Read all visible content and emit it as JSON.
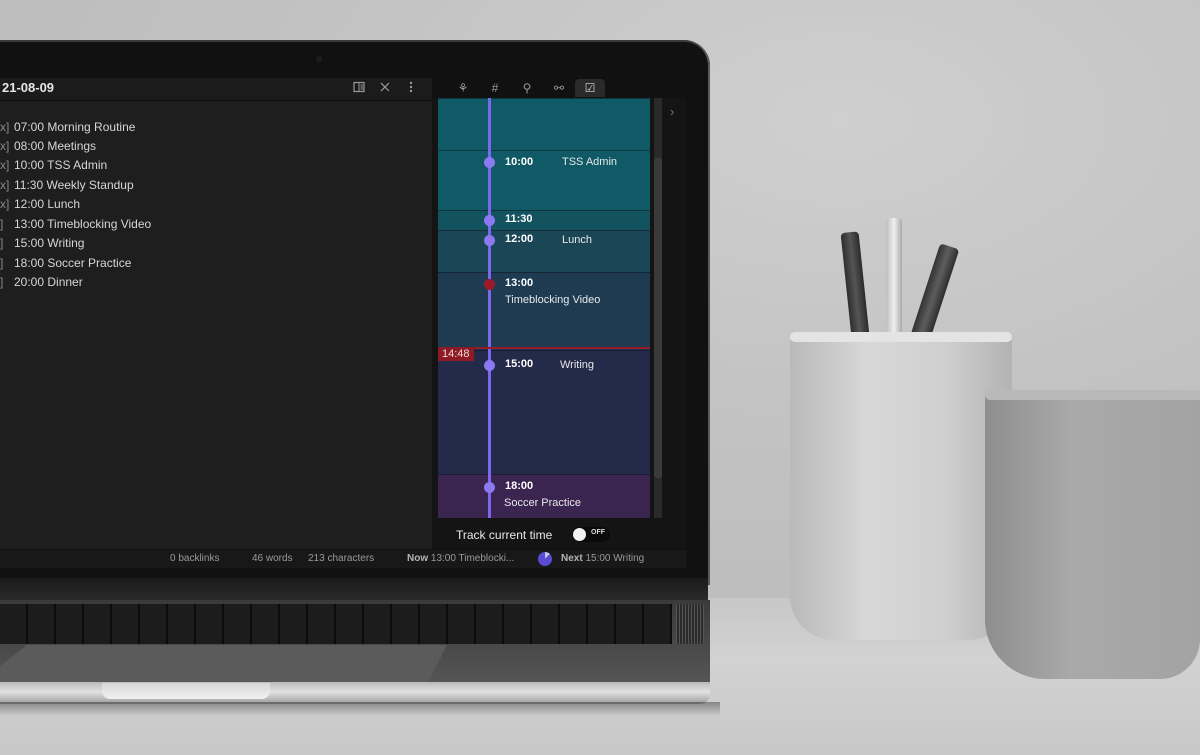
{
  "editor": {
    "title": "21-08-09",
    "header_icons": [
      "reading-view-icon",
      "close-icon",
      "more-options-icon"
    ],
    "tasks": [
      {
        "checkbox": "x]",
        "text": "07:00 Morning Routine",
        "done": true
      },
      {
        "checkbox": "x]",
        "text": "08:00 Meetings",
        "done": true
      },
      {
        "checkbox": "x]",
        "text": "10:00 TSS Admin",
        "done": true
      },
      {
        "checkbox": "x]",
        "text": "11:30 Weekly Standup",
        "done": true
      },
      {
        "checkbox": "x]",
        "text": "12:00 Lunch",
        "done": true
      },
      {
        "checkbox": " ]",
        "text": "13:00 Timeblocking Video",
        "done": false
      },
      {
        "checkbox": " ]",
        "text": "15:00 Writing",
        "done": false
      },
      {
        "checkbox": " ]",
        "text": "18:00 Soccer Practice",
        "done": false
      },
      {
        "checkbox": " ]",
        "text": "20:00 Dinner",
        "done": false
      }
    ]
  },
  "sidebar": {
    "tabs": [
      {
        "icon": "graph-view-icon",
        "glyph": "⚘"
      },
      {
        "icon": "tag-icon",
        "glyph": "#"
      },
      {
        "icon": "backlinks-icon",
        "glyph": "⚲"
      },
      {
        "icon": "outgoing-links-icon",
        "glyph": "⚯"
      },
      {
        "icon": "day-planner-icon",
        "glyph": "☑",
        "active": true
      }
    ],
    "collapse_glyph": "›",
    "timeline": {
      "now_time": "14:48",
      "events": [
        {
          "time": "10:00",
          "name": "TSS Admin",
          "inline": true,
          "past": false
        },
        {
          "time": "11:30",
          "name": "",
          "inline": true,
          "past": false
        },
        {
          "time": "12:00",
          "name": "Lunch",
          "inline": true,
          "past": false
        },
        {
          "time": "13:00",
          "name": "Timeblocking Video",
          "inline": false,
          "past": true
        },
        {
          "time": "15:00",
          "name": "Writing",
          "inline": true,
          "past": false
        },
        {
          "time": "18:00",
          "name": "Soccer Practice",
          "inline": false,
          "past": false
        }
      ],
      "colors": {
        "teal": "#0f5a66",
        "slate": "#1f3b52",
        "navy": "#232a4a",
        "plum": "#3a2550",
        "accent": "#7b68ee",
        "now": "#9b1a2a"
      }
    },
    "track_current_time": {
      "label": "Track current time",
      "state": "OFF"
    }
  },
  "statusbar": {
    "backlinks": "0 backlinks",
    "words": "46 words",
    "characters": "213 characters",
    "now_label": "Now",
    "now_value": "13:00 Timeblocki...",
    "progress_fraction": 0.12,
    "next_label": "Next",
    "next_value": "15:00 Writing"
  }
}
